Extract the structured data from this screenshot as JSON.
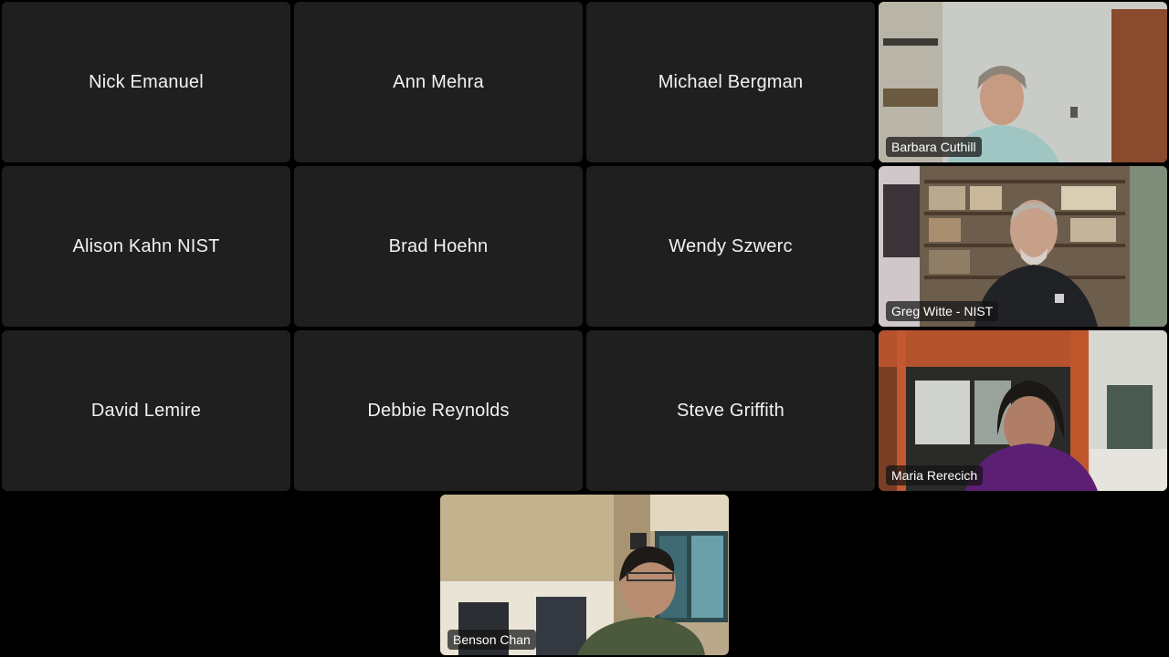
{
  "participants_no_video": [
    {
      "name": "Nick Emanuel"
    },
    {
      "name": "Ann Mehra"
    },
    {
      "name": "Michael Bergman"
    },
    {
      "name": "Alison Kahn NIST"
    },
    {
      "name": "Brad Hoehn"
    },
    {
      "name": "Wendy Szwerc"
    },
    {
      "name": "David Lemire"
    },
    {
      "name": "Debbie Reynolds"
    },
    {
      "name": "Steve Griffith"
    }
  ],
  "participants_video": [
    {
      "name": "Barbara Cuthill"
    },
    {
      "name": "Greg Witte - NIST"
    },
    {
      "name": "Maria Rerecich"
    },
    {
      "name": "Benson Chan"
    }
  ],
  "colors": {
    "background": "#000000",
    "tile": "#1f1f1f",
    "name_text": "#f2f2f2"
  }
}
